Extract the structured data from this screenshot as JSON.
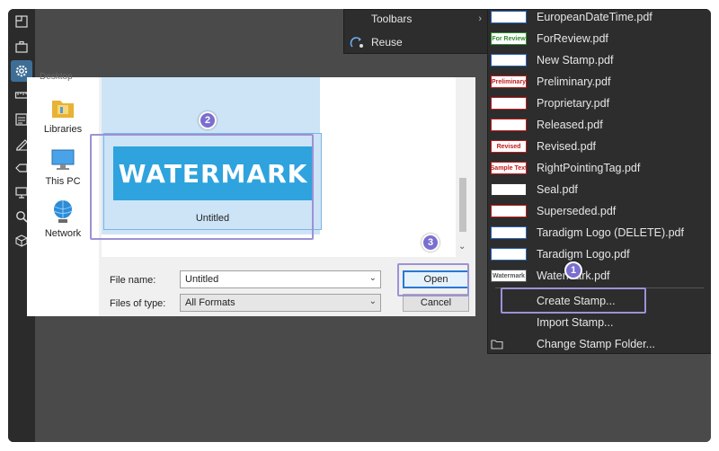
{
  "context_menu": {
    "items": [
      {
        "label": "Toolbars",
        "arrow": "›"
      },
      {
        "label": "Reuse"
      }
    ]
  },
  "stamp_menu": {
    "items": [
      {
        "label": "EuropeanDateTime.pdf",
        "thumb": "",
        "thumb_color": "#2a62b5"
      },
      {
        "label": "ForReview.pdf",
        "thumb": "For Review",
        "thumb_color": "#2e8b2e"
      },
      {
        "label": "New Stamp.pdf",
        "thumb": "",
        "thumb_color": "#2a62b5"
      },
      {
        "label": "Preliminary.pdf",
        "thumb": "Preliminary",
        "thumb_color": "#c21b1b"
      },
      {
        "label": "Proprietary.pdf",
        "thumb": "",
        "thumb_color": "#c21b1b"
      },
      {
        "label": "Released.pdf",
        "thumb": "",
        "thumb_color": "#c21b1b"
      },
      {
        "label": "Revised.pdf",
        "thumb": "Revised",
        "thumb_color": "#c21b1b"
      },
      {
        "label": "RightPointingTag.pdf",
        "thumb": "Sample Text",
        "thumb_color": "#c21b1b"
      },
      {
        "label": "Seal.pdf",
        "thumb": "",
        "thumb_color": "#333333"
      },
      {
        "label": "Superseded.pdf",
        "thumb": "",
        "thumb_color": "#c21b1b"
      },
      {
        "label": "Taradigm Logo (DELETE).pdf",
        "thumb": "",
        "thumb_color": "#2a62b5"
      },
      {
        "label": "Taradigm Logo.pdf",
        "thumb": "",
        "thumb_color": "#2a62b5"
      },
      {
        "label": "Watermark.pdf",
        "thumb": "Watermark",
        "thumb_color": "#555555"
      }
    ],
    "actions": [
      {
        "label": "Create Stamp..."
      },
      {
        "label": "Import Stamp..."
      },
      {
        "label": "Change Stamp Folder..."
      }
    ]
  },
  "dialog": {
    "nav_cut": "Desktop",
    "nav": [
      {
        "label": "Libraries",
        "icon": "libraries-icon"
      },
      {
        "label": "This PC",
        "icon": "computer-icon"
      },
      {
        "label": "Network",
        "icon": "network-icon"
      }
    ],
    "tile": {
      "thumb_text": "WATERMARK",
      "name": "Untitled"
    },
    "file_name_label": "File name:",
    "file_name_value": "Untitled",
    "files_of_type_label": "Files of type:",
    "files_of_type_value": "All Formats",
    "open_label": "Open",
    "cancel_label": "Cancel"
  },
  "steps": [
    "1",
    "2",
    "3"
  ],
  "colors": {
    "app_bg": "#4a4a4a",
    "menu_bg": "#2d2d2d",
    "highlight": "#9c92d6",
    "badge": "#7a6fcf",
    "watermark_blue": "#2ea3dd"
  }
}
